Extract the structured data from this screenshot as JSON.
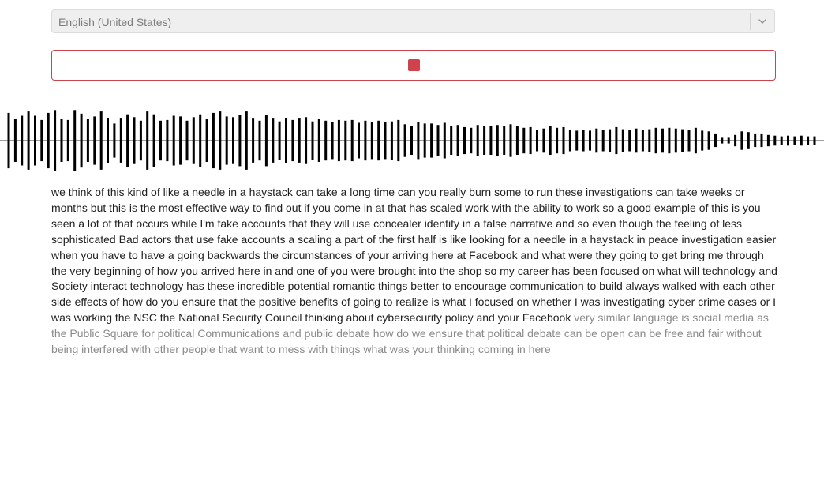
{
  "language_select": {
    "selected": "English (United States)",
    "icon": "chevron-down-icon"
  },
  "record_button": {
    "icon": "stop-icon",
    "color": "#d0434c",
    "state": "recording"
  },
  "waveform": {
    "amplitudes": [
      0.78,
      0.6,
      0.7,
      0.82,
      0.7,
      0.58,
      0.78,
      0.86,
      0.6,
      0.58,
      0.86,
      0.76,
      0.6,
      0.68,
      0.82,
      0.64,
      0.48,
      0.62,
      0.74,
      0.66,
      0.56,
      0.82,
      0.74,
      0.56,
      0.58,
      0.7,
      0.68,
      0.56,
      0.66,
      0.74,
      0.6,
      0.78,
      0.82,
      0.68,
      0.66,
      0.72,
      0.82,
      0.62,
      0.56,
      0.72,
      0.62,
      0.54,
      0.64,
      0.58,
      0.62,
      0.66,
      0.54,
      0.6,
      0.56,
      0.52,
      0.58,
      0.56,
      0.58,
      0.5,
      0.56,
      0.52,
      0.56,
      0.52,
      0.54,
      0.58,
      0.46,
      0.4,
      0.52,
      0.48,
      0.48,
      0.44,
      0.5,
      0.4,
      0.44,
      0.38,
      0.36,
      0.44,
      0.4,
      0.4,
      0.44,
      0.4,
      0.46,
      0.4,
      0.36,
      0.38,
      0.3,
      0.34,
      0.4,
      0.36,
      0.38,
      0.3,
      0.28,
      0.3,
      0.28,
      0.34,
      0.3,
      0.32,
      0.38,
      0.32,
      0.3,
      0.34,
      0.3,
      0.32,
      0.36,
      0.34,
      0.36,
      0.34,
      0.32,
      0.3,
      0.36,
      0.28,
      0.26,
      0.18,
      0.08,
      0.08,
      0.16,
      0.26,
      0.24,
      0.18,
      0.18,
      0.16,
      0.14,
      0.12,
      0.14,
      0.12,
      0.14,
      0.12,
      0.12
    ]
  },
  "transcript": {
    "final": "we think of this kind of like a needle in a haystack can take a long time can you really burn some to run these investigations can take weeks or months but this is the most effective way to find out if you come in at that has scaled work with the ability to work so a good example of this is you seen a lot of that occurs while I'm fake accounts that they will use concealer identity in a false narrative and so even though the feeling of less sophisticated Bad actors that use fake accounts a scaling a part of the first half is like looking for a needle in a haystack in peace investigation easier when you have to have a going backwards the circumstances of your arriving here at Facebook and what were they going to get bring me through the very beginning of how you arrived here in and one of you were brought into the shop so my career has been focused on what will technology and Society interact technology has these incredible potential romantic things better to encourage communication to build always walked with each other side effects of how do you ensure that the positive benefits of going to realize is what I focused on whether I was investigating cyber crime cases or I was working the NSC the National Security Council thinking about cybersecurity policy and your Facebook",
    "interim": "very similar language is social media as the Public Square for political Communications and public debate how do we ensure that political debate can be open can be free and fair without being interfered with other people that want to mess with things what was your thinking coming in here"
  }
}
